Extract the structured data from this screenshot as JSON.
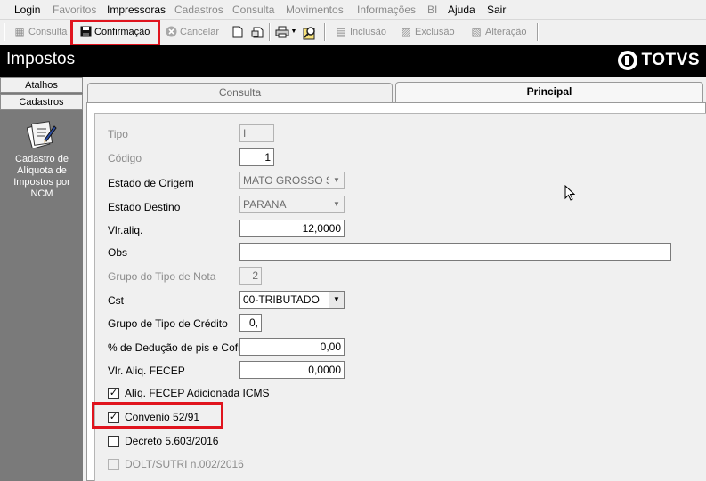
{
  "menu": [
    {
      "label": "Login",
      "enabled": true
    },
    {
      "label": "Favoritos",
      "enabled": false
    },
    {
      "label": "Impressoras",
      "enabled": true
    },
    {
      "label": "Cadastros",
      "enabled": false
    },
    {
      "label": "Consulta",
      "enabled": false
    },
    {
      "label": "Movimentos",
      "enabled": false
    },
    {
      "label": "Informações",
      "enabled": false
    },
    {
      "label": "BI",
      "enabled": false
    },
    {
      "label": "Ajuda",
      "enabled": true
    },
    {
      "label": "Sair",
      "enabled": true
    }
  ],
  "toolbar": {
    "consulta": "Consulta",
    "confirmacao": "Confirmação",
    "cancelar": "Cancelar",
    "inclusao": "Inclusão",
    "exclusao": "Exclusão",
    "alteracao": "Alteração"
  },
  "header": {
    "title": "Impostos",
    "brand": "TOTVS"
  },
  "left_panel": {
    "atalhos": "Atalhos",
    "cadastros": "Cadastros",
    "shortcut_label": "Cadastro de Alíquota de Impostos por NCM"
  },
  "tabs": {
    "consulta": "Consulta",
    "principal": "Principal"
  },
  "form": {
    "tipo": {
      "label": "Tipo",
      "value": "I"
    },
    "codigo": {
      "label": "Código",
      "value": "1"
    },
    "estado_origem": {
      "label": "Estado de Origem",
      "value": "MATO GROSSO SU"
    },
    "estado_destino": {
      "label": "Estado Destino",
      "value": "PARANA"
    },
    "vlr_aliq": {
      "label": "Vlr.aliq.",
      "value": "12,0000"
    },
    "obs": {
      "label": "Obs",
      "value": ""
    },
    "grupo_tipo_nota": {
      "label": "Grupo do Tipo de Nota",
      "value": "2"
    },
    "cst": {
      "label": "Cst",
      "value": "00-TRIBUTADO"
    },
    "grupo_tipo_credito": {
      "label": "Grupo de Tipo de Crédito",
      "value": "0,"
    },
    "deducao_pis_cofins": {
      "label": "% de Dedução de pis e Cofir",
      "value": "0,00"
    },
    "vlr_aliq_fecep": {
      "label": "Vlr. Aliq. FECEP",
      "value": "0,0000"
    }
  },
  "checkboxes": {
    "fecep_icms": {
      "label": "Alíq. FECEP Adicionada ICMS",
      "checked": true,
      "enabled": true
    },
    "convenio": {
      "label": "Convenio 52/91",
      "checked": true,
      "enabled": true
    },
    "decreto": {
      "label": "Decreto 5.603/2016",
      "checked": false,
      "enabled": true
    },
    "dolt_sutri": {
      "label": "DOLT/SUTRI n.002/2016",
      "checked": false,
      "enabled": false
    }
  },
  "colors": {
    "highlight": "#e0141e",
    "title_bar": "#000000",
    "left_panel": "#7a7a7a"
  }
}
